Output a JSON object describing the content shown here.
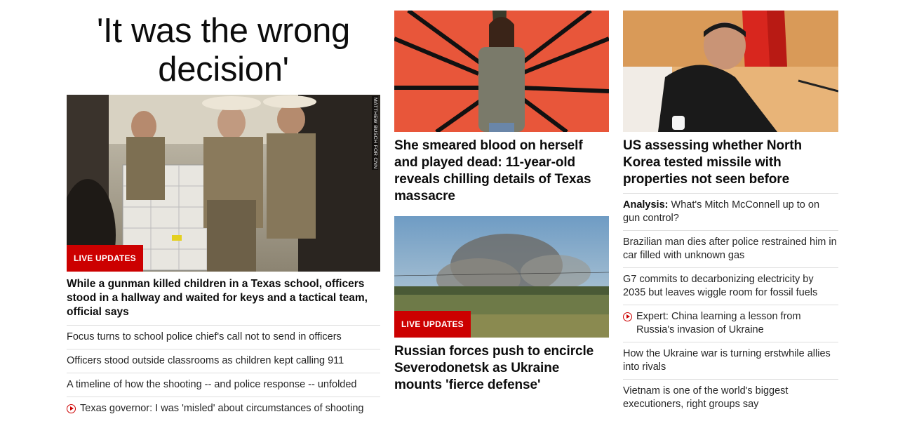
{
  "col1": {
    "headline": "'It was the wrong decision'",
    "image_credit": "MATTHEW BUSCH FOR CNN",
    "badge": "LIVE UPDATES",
    "lead_title": "While a gunman killed children in a Texas school, officers stood in a hallway and waited for keys and a tactical team, official says",
    "links": [
      {
        "text": "Focus turns to school police chief's call not to send in officers",
        "video": false
      },
      {
        "text": "Officers stood outside classrooms as children kept calling 911",
        "video": false
      },
      {
        "text": "A timeline of how the shooting -- and police response -- unfolded",
        "video": false
      },
      {
        "text": "Texas governor: I was 'misled' about circumstances of shooting",
        "video": true
      }
    ]
  },
  "col2": {
    "story1_title": "She smeared blood on herself and played dead: 11-year-old reveals chilling details of Texas massacre",
    "badge": "LIVE UPDATES",
    "story2_title": "Russian forces push to encircle Severodonetsk as Ukraine mounts 'fierce defense'"
  },
  "col3": {
    "story_title": "US assessing whether North Korea tested missile with properties not seen before",
    "links": [
      {
        "kicker": "Analysis:",
        "text": " What's Mitch McConnell up to on gun control?",
        "video": false
      },
      {
        "kicker": "",
        "text": "Brazilian man dies after police restrained him in car filled with unknown gas",
        "video": false
      },
      {
        "kicker": "",
        "text": "G7 commits to decarbonizing electricity by 2035 but leaves wiggle room for fossil fuels",
        "video": false
      },
      {
        "kicker": "",
        "text": "Expert: China learning a lesson from Russia's invasion of Ukraine",
        "video": true
      },
      {
        "kicker": "",
        "text": "How the Ukraine war is turning erstwhile allies into rivals",
        "video": false
      },
      {
        "kicker": "",
        "text": "Vietnam is one of the world's biggest executioners, right groups say",
        "video": false
      }
    ]
  },
  "colors": {
    "accent": "#cc0000",
    "divider": "#dedede",
    "text": "#0c0c0c"
  }
}
